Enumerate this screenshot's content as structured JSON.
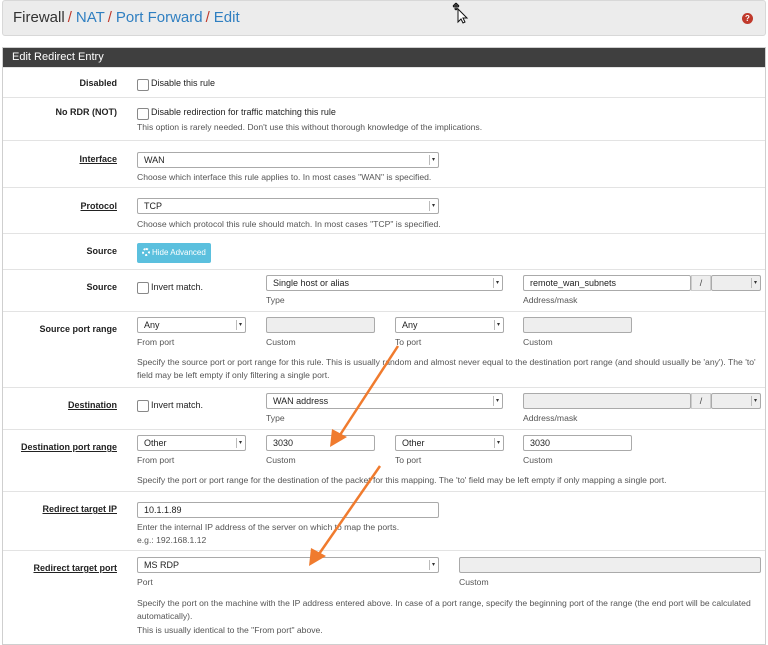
{
  "breadcrumb": {
    "part0": "Firewall",
    "part1": "NAT",
    "part2": "Port Forward",
    "part3": "Edit",
    "separator": "/"
  },
  "help_icon": "question-icon",
  "panel_title": "Edit Redirect Entry",
  "disabled": {
    "label": "Disabled",
    "checkbox_text": "Disable this rule"
  },
  "nordr": {
    "label": "No RDR (NOT)",
    "checkbox_text": "Disable redirection for traffic matching this rule",
    "help": "This option is rarely needed. Don't use this without thorough knowledge of the implications."
  },
  "interface": {
    "label": "Interface",
    "value": "WAN",
    "help": "Choose which interface this rule applies to. In most cases \"WAN\" is specified."
  },
  "protocol": {
    "label": "Protocol",
    "value": "TCP",
    "help": "Choose which protocol this rule should match. In most cases \"TCP\" is specified."
  },
  "source_adv": {
    "label": "Source",
    "button": "Hide Advanced"
  },
  "source": {
    "label": "Source",
    "invert": "Invert match.",
    "type_value": "Single host or alias",
    "type_caption": "Type",
    "address_value": "remote_wan_subnets",
    "address_caption": "Address/mask",
    "slash": "/"
  },
  "source_port": {
    "label": "Source port range",
    "from_value": "Any",
    "from_caption": "From port",
    "custom1_caption": "Custom",
    "to_value": "Any",
    "to_caption": "To port",
    "custom2_caption": "Custom",
    "help": "Specify the source port or port range for this rule. This is usually random and almost never equal to the destination port range (and should usually be 'any'). The 'to' field may be left empty if only filtering a single port."
  },
  "destination": {
    "label": "Destination",
    "invert": "Invert match.",
    "type_value": "WAN address",
    "type_caption": "Type",
    "address_caption": "Address/mask",
    "slash": "/"
  },
  "dest_port": {
    "label": "Destination port range",
    "from_value": "Other",
    "from_caption": "From port",
    "custom1_value": "3030",
    "custom1_caption": "Custom",
    "to_value": "Other",
    "to_caption": "To port",
    "custom2_value": "3030",
    "custom2_caption": "Custom",
    "help": "Specify the port or port range for the destination of the packet for this mapping. The 'to' field may be left empty if only mapping a single port."
  },
  "redirect_ip": {
    "label": "Redirect target IP",
    "value": "10.1.1.89",
    "help1": "Enter the internal IP address of the server on which to map the ports.",
    "help2": "e.g.: 192.168.1.12"
  },
  "redirect_port": {
    "label": "Redirect target port",
    "value": "MS RDP",
    "port_caption": "Port",
    "custom_caption": "Custom",
    "help1": "Specify the port on the machine with the IP address entered above. In case of a port range, specify the beginning port of the range (the end port will be calculated automatically).",
    "help2": "This is usually identical to the \"From port\" above."
  },
  "colors": {
    "accent": "#2f7fc1",
    "separator": "#c0392b",
    "arrow": "#f07b2e",
    "heading": "#3f3f3f",
    "button": "#5bc0de"
  }
}
